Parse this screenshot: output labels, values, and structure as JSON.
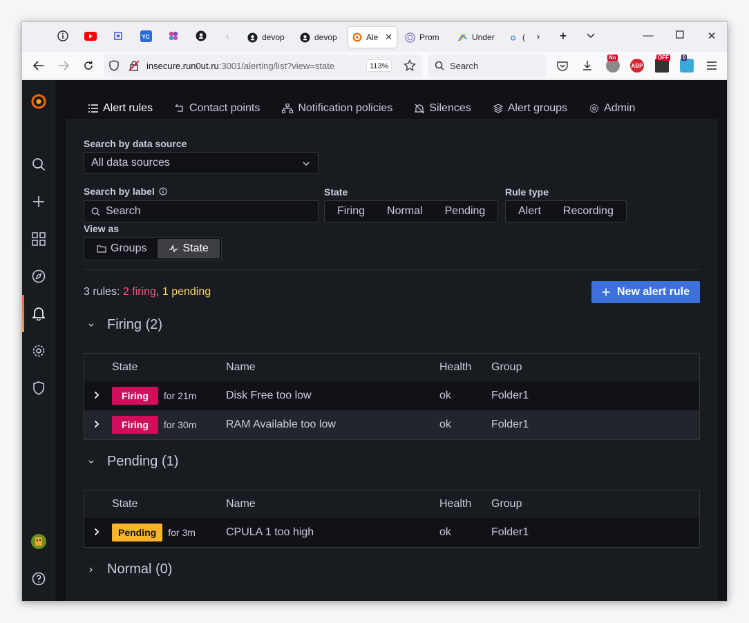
{
  "browser": {
    "tabs": [
      {
        "label": "devop"
      },
      {
        "label": "devop"
      },
      {
        "label": "Ale"
      },
      {
        "label": "Prom"
      },
      {
        "label": "Under"
      },
      {
        "label": "("
      }
    ],
    "address": {
      "host": "insecure.run0ut.ru",
      "path": ":3001/alerting/list?view=state"
    },
    "zoom": "113%",
    "search_placeholder": "Search",
    "ext_badges": {
      "no": "No",
      "abp": "ABP",
      "off": "OFF",
      "zero": "0"
    }
  },
  "tabs": [
    {
      "label": "Alert rules"
    },
    {
      "label": "Contact points"
    },
    {
      "label": "Notification policies"
    },
    {
      "label": "Silences"
    },
    {
      "label": "Alert groups"
    },
    {
      "label": "Admin"
    }
  ],
  "filters": {
    "datasource_label": "Search by data source",
    "datasource_value": "All data sources",
    "label_label": "Search by label",
    "label_placeholder": "Search",
    "state_label": "State",
    "state_options": [
      "Firing",
      "Normal",
      "Pending"
    ],
    "ruletype_label": "Rule type",
    "ruletype_options": [
      "Alert",
      "Recording"
    ],
    "viewas_label": "View as",
    "viewas_options": [
      "Groups",
      "State"
    ]
  },
  "summary": {
    "prefix": "3 rules: ",
    "firing": "2 firing",
    "sep": ", ",
    "pending": "1 pending"
  },
  "new_rule_button": "New alert rule",
  "columns": {
    "state": "State",
    "name": "Name",
    "health": "Health",
    "group": "Group"
  },
  "sections": {
    "firing": {
      "title": "Firing (2)",
      "rows": [
        {
          "state": "Firing",
          "duration": "for 21m",
          "name": "Disk Free too low",
          "health": "ok",
          "group": "Folder1"
        },
        {
          "state": "Firing",
          "duration": "for 30m",
          "name": "RAM Available too low",
          "health": "ok",
          "group": "Folder1"
        }
      ]
    },
    "pending": {
      "title": "Pending (1)",
      "rows": [
        {
          "state": "Pending",
          "duration": "for 3m",
          "name": "CPULA 1 too high",
          "health": "ok",
          "group": "Folder1"
        }
      ]
    },
    "normal": {
      "title": "Normal (0)"
    }
  },
  "colors": {
    "firing": "#d10e5c",
    "pending": "#f8b52c",
    "primary": "#3d71d9"
  }
}
